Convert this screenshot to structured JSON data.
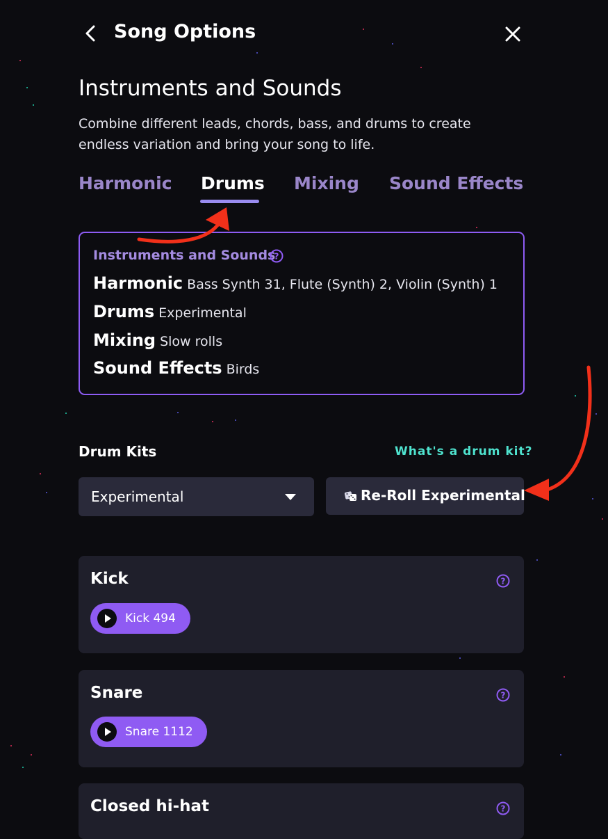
{
  "header": {
    "title": "Song Options",
    "back_icon": "chevron-left-icon",
    "close_icon": "close-icon"
  },
  "section": {
    "title": "Instruments and Sounds",
    "description": "Combine different leads, chords, bass, and drums to create endless variation and bring your song to life."
  },
  "tabs": [
    {
      "label": "Harmonic",
      "active": false
    },
    {
      "label": "Drums",
      "active": true
    },
    {
      "label": "Mixing",
      "active": false
    },
    {
      "label": "Sound Effects",
      "active": false
    }
  ],
  "summary": {
    "heading": "Instruments and Sounds",
    "rows": [
      {
        "key": "Harmonic",
        "value": "Bass Synth 31, Flute (Synth) 2, Violin (Synth) 1"
      },
      {
        "key": "Drums",
        "value": "Experimental"
      },
      {
        "key": "Mixing",
        "value": "Slow rolls"
      },
      {
        "key": "Sound Effects",
        "value": "Birds"
      }
    ]
  },
  "drum_kits": {
    "label": "Drum Kits",
    "help_link": "What's a drum kit?",
    "selected": "Experimental",
    "reroll_label": "Re-Roll Experimental"
  },
  "cards": [
    {
      "title": "Kick",
      "sample": "Kick 494"
    },
    {
      "title": "Snare",
      "sample": "Snare 1112"
    },
    {
      "title": "Closed hi-hat"
    }
  ],
  "colors": {
    "background": "#0c0c10",
    "accent": "#8f5bf3",
    "tab_inactive": "#9a86c9",
    "link": "#4fe3cf",
    "panel": "#2a2a3a",
    "card": "#1f1f2b",
    "annotation": "#f2301a"
  }
}
